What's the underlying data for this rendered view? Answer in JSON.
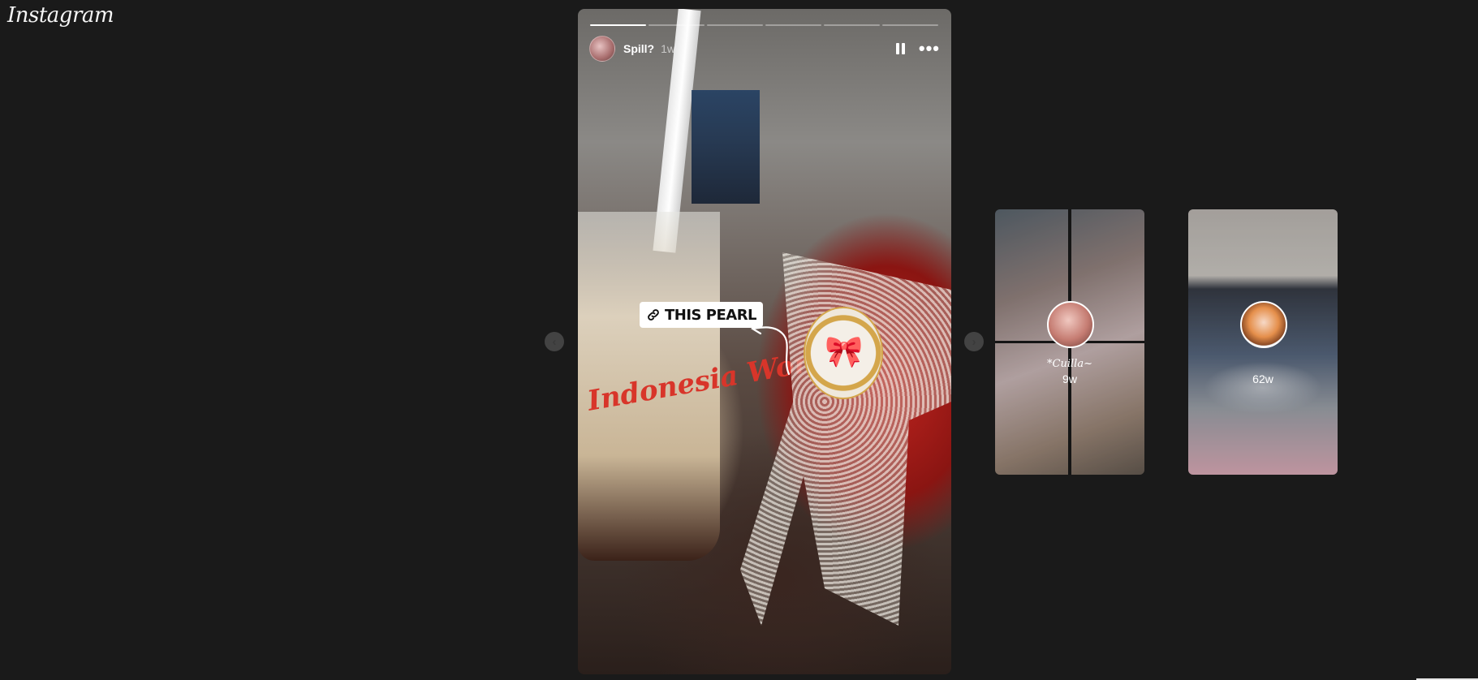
{
  "app": {
    "logo": "Instagram"
  },
  "story": {
    "username": "Spill?",
    "time": "1w",
    "progress_total": 6,
    "progress_done": 1,
    "link_sticker": {
      "label": "THIS PEARL",
      "icon": "link-icon"
    },
    "cup_text": "Indonesia World",
    "controls": {
      "pause_icon": "pause-icon",
      "more_icon": "more-options-icon",
      "more_glyph": "•••"
    }
  },
  "nav": {
    "prev_glyph": "‹",
    "next_glyph": "›"
  },
  "previews": [
    {
      "name": "*Cuilla~",
      "time": "9w"
    },
    {
      "name": "",
      "time": "62w"
    }
  ]
}
